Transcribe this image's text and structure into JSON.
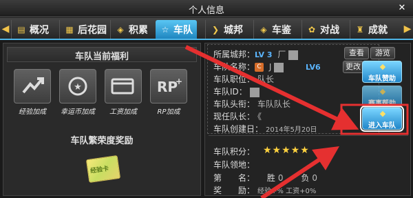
{
  "window": {
    "title": "个人信息",
    "close": "✕"
  },
  "tabs": [
    {
      "label": "概况",
      "icon": "id-card-icon"
    },
    {
      "label": "后花园",
      "icon": "garden-icon"
    },
    {
      "label": "积累",
      "icon": "stack-icon"
    },
    {
      "label": "车队",
      "icon": "star-icon",
      "active": true
    },
    {
      "label": "城邦",
      "icon": "chevron-icon"
    },
    {
      "label": "车鉴",
      "icon": "stack-icon"
    },
    {
      "label": "对战",
      "icon": "paw-icon"
    },
    {
      "label": "成就",
      "icon": "trophy-icon"
    }
  ],
  "left": {
    "welfare_title": "车队当前福利",
    "perks": [
      "经验加成",
      "幸运币加成",
      "工资加成",
      "RP加成"
    ],
    "perk_icons": [
      "exp-up-icon",
      "lucky-coin-icon",
      "salary-card-icon",
      "rp-plus-icon"
    ],
    "prosperity_title": "车队繁荣度奖励",
    "ticket_text": "经验卡"
  },
  "info": {
    "city_k": "所属城邦：",
    "city_lv": "LV 3",
    "city_v": "厂",
    "name_k": "车队名称：",
    "name_v": "J",
    "name_lv": "LV6",
    "position_k": "车队职位：",
    "position_v": "队长",
    "id_k": "车队ID：",
    "title_k": "车队头衔：",
    "title_v": "车队队长",
    "captain_k": "现任队长：",
    "captain_v": "《",
    "created_k": "车队创建日：",
    "created_v": "2014年5月20日",
    "score_k": "车队积分：",
    "stars": "★★★★★",
    "territory_k": "车队领地：",
    "rank_k": "第　　名：",
    "win_k": "胜",
    "win_v": "0",
    "lose_k": "负",
    "lose_v": "0",
    "reward_k": "奖　　励：",
    "reward_v": "经验+% 工资+0%"
  },
  "buttons": {
    "view": "查看",
    "browse": "游览",
    "more": "更改",
    "team_gift": "车队赞助",
    "team_help": "赛事帮助",
    "enter_team": "进入车队"
  },
  "colors": {
    "accent": "#4fb6e8",
    "arrow": "#e53030",
    "gold": "#f2c94c"
  }
}
